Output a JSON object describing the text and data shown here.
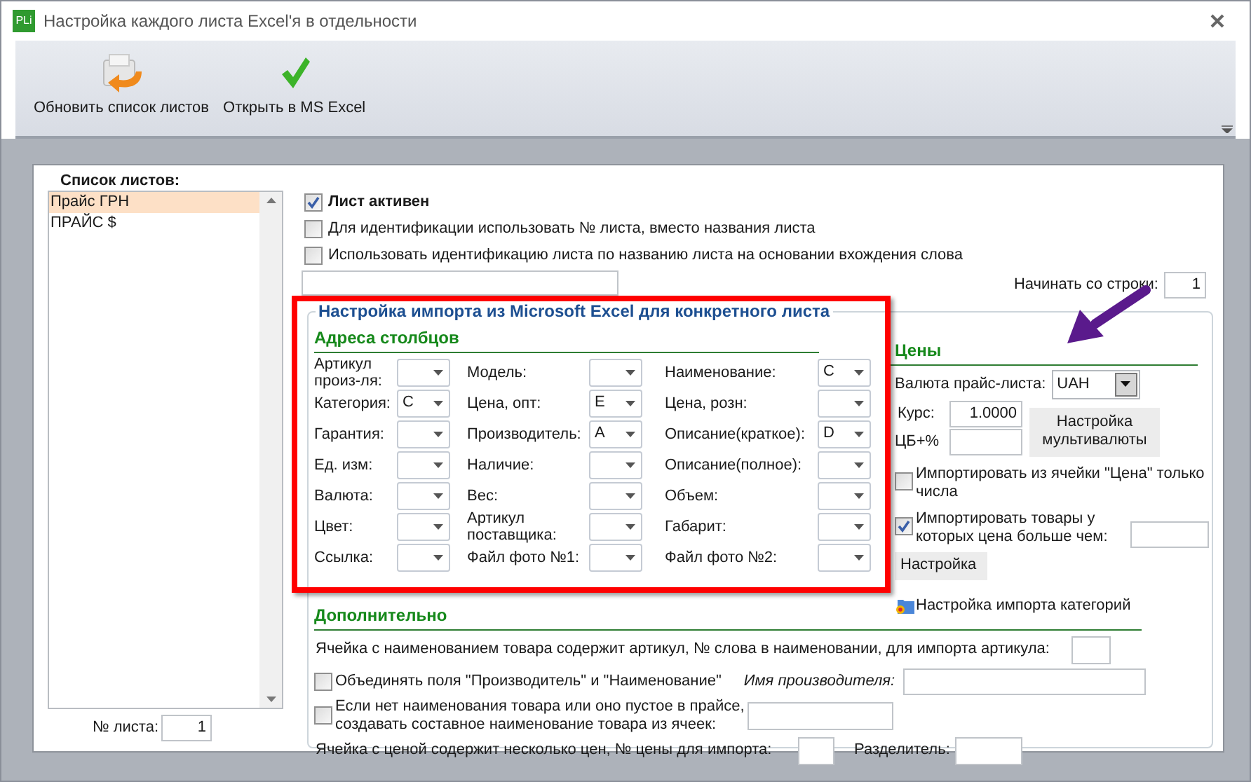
{
  "window": {
    "app_icon_text": "PLi",
    "title": "Настройка каждого листа Excel'я в отдельности"
  },
  "toolbar": [
    {
      "label": "Обновить список листов",
      "kind": "refresh"
    },
    {
      "label": "Открыть в MS Excel",
      "kind": "check"
    }
  ],
  "sheet_list": {
    "title": "Список листов:",
    "items": [
      {
        "label": "Прайс ГРН",
        "selected": true
      },
      {
        "label": "ПРАЙС $",
        "selected": false
      }
    ],
    "number_label": "№ листа:",
    "number_value": "1"
  },
  "options": [
    {
      "label": "Лист активен",
      "checked": true,
      "bold": true
    },
    {
      "label": "Для идентификации использовать № листа, вместо названия листа",
      "checked": false,
      "bold": false
    },
    {
      "label": "Использовать идентификацию листа по названию листа на основании вхождения слова",
      "checked": false,
      "bold": false
    }
  ],
  "start_row": {
    "label": "Начинать со строки:",
    "value": "1"
  },
  "import_group": {
    "title": "Настройка импорта из Microsoft Excel для конкретного листа",
    "columns_title": "Адреса столбцов",
    "fields": [
      {
        "label": "Артикул произ-ля:"
      },
      {
        "label": "Модель:"
      },
      {
        "label": "Наименование:",
        "value": "C"
      },
      {
        "label": "Категория:",
        "value": "C"
      },
      {
        "label": "Цена, опт:",
        "value": "E"
      },
      {
        "label": "Цена, розн:"
      },
      {
        "label": "Гарантия:"
      },
      {
        "label": "Производитель:",
        "value": "A"
      },
      {
        "label": "Описание(краткое):",
        "value": "D"
      },
      {
        "label": "Ед. изм:"
      },
      {
        "label": "Наличие:"
      },
      {
        "label": "Описание(полное):"
      },
      {
        "label": "Валюта:"
      },
      {
        "label": "Вес:"
      },
      {
        "label": "Объем:"
      },
      {
        "label": "Цвет:"
      },
      {
        "label": "Артикул поставщика:"
      },
      {
        "label": "Габарит:"
      },
      {
        "label": "Ссылка:"
      },
      {
        "label": "Файл фото №1:"
      },
      {
        "label": "Файл фото №2:"
      }
    ]
  },
  "prices": {
    "title": "Цены",
    "currency_label": "Валюта прайс-листа:",
    "currency": "UAH",
    "rate_label": "Курс:",
    "rate": "1.0000",
    "cb_label": "ЦБ+%",
    "multicurrency_button": "Настройка мультивалюты",
    "options": [
      {
        "label": "Импортировать из ячейки \"Цена\" только числа",
        "checked": false,
        "has_field": false
      },
      {
        "label": "Импортировать товары у которых цена больше чем:",
        "checked": true,
        "has_field": true
      }
    ],
    "settings_button": "Настройка",
    "categories_link": "Настройка импорта категорий"
  },
  "extra": {
    "title": "Дополнительно",
    "article_label": "Ячейка с наименованием товара содержит артикул, № слова в наименовании, для импорта артикула:",
    "merge": {
      "label": "Объединять поля \"Производитель\" и \"Наименование\"",
      "checked": false
    },
    "manufacturer_label": "Имя производителя:",
    "composite": {
      "label": "Если нет наименования товара или оно пустое в прайсе, создавать составное наименование товара из ячеек:",
      "checked": false
    },
    "multi_price_label": "Ячейка с ценой содержит несколько цен, № цены для импорта:",
    "separator_label": "Разделитель:"
  }
}
